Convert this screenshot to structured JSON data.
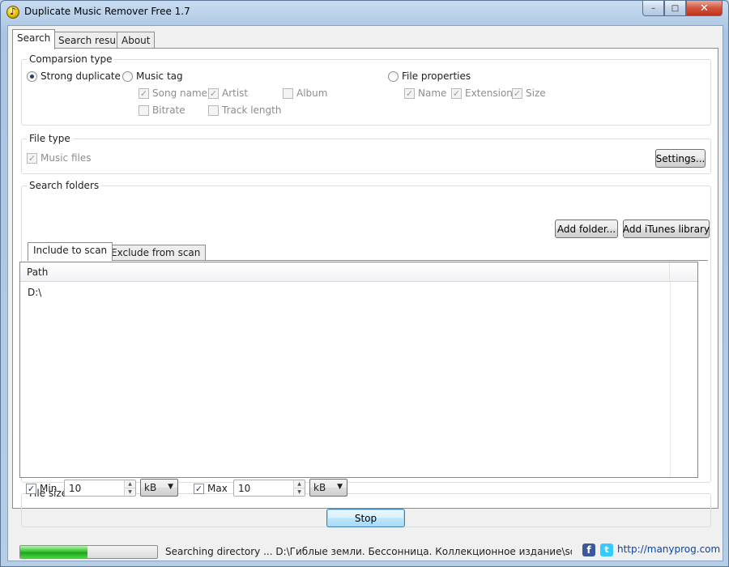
{
  "window": {
    "title": "Duplicate Music Remover Free 1.7",
    "controls": {
      "minimize": "–",
      "maximize": "□",
      "close": "✕"
    }
  },
  "tabs": [
    {
      "label": "Search",
      "active": true
    },
    {
      "label": "Search result",
      "active": false
    },
    {
      "label": "About",
      "active": false
    }
  ],
  "comparison": {
    "legend": "Comparsion type",
    "strong": {
      "label": "Strong duplicate",
      "selected": true
    },
    "music_tag": {
      "label": "Music tag",
      "selected": false,
      "options": [
        {
          "label": "Song name",
          "checked": true
        },
        {
          "label": "Artist",
          "checked": true
        },
        {
          "label": "Album",
          "checked": false
        },
        {
          "label": "Bitrate",
          "checked": false
        },
        {
          "label": "Track length",
          "checked": false
        }
      ]
    },
    "file_props": {
      "label": "File properties",
      "selected": false,
      "options": [
        {
          "label": "Name",
          "checked": true
        },
        {
          "label": "Extension",
          "checked": true
        },
        {
          "label": "Size",
          "checked": true
        }
      ]
    }
  },
  "file_type": {
    "legend": "File type",
    "music_files": {
      "label": "Music files",
      "checked": true
    },
    "settings_button": "Settings..."
  },
  "search_folders": {
    "legend": "Search folders",
    "add_folder": "Add folder...",
    "add_itunes": "Add iTunes library",
    "tabs": [
      {
        "label": "Include to scan",
        "active": true
      },
      {
        "label": "Exclude from scan",
        "active": false
      }
    ],
    "column": "Path",
    "rows": [
      "D:\\"
    ]
  },
  "file_size": {
    "legend": "File size",
    "min": {
      "label": "Min",
      "checked": true,
      "value": "10",
      "unit": "kB"
    },
    "max": {
      "label": "Max",
      "checked": true,
      "value": "10",
      "unit": "kB"
    }
  },
  "stop_button": "Stop",
  "status": {
    "progress_percent": 49,
    "text": "Searching directory ... D:\\Гиблые земли. Бессонница. Коллекционное издание\\sounds\\menu",
    "link": "http://manyprog.com",
    "facebook_glyph": "f",
    "twitter_glyph": "t"
  },
  "glyphs": {
    "check": "✓",
    "up": "▲",
    "down": "▼",
    "caret": "▼"
  }
}
